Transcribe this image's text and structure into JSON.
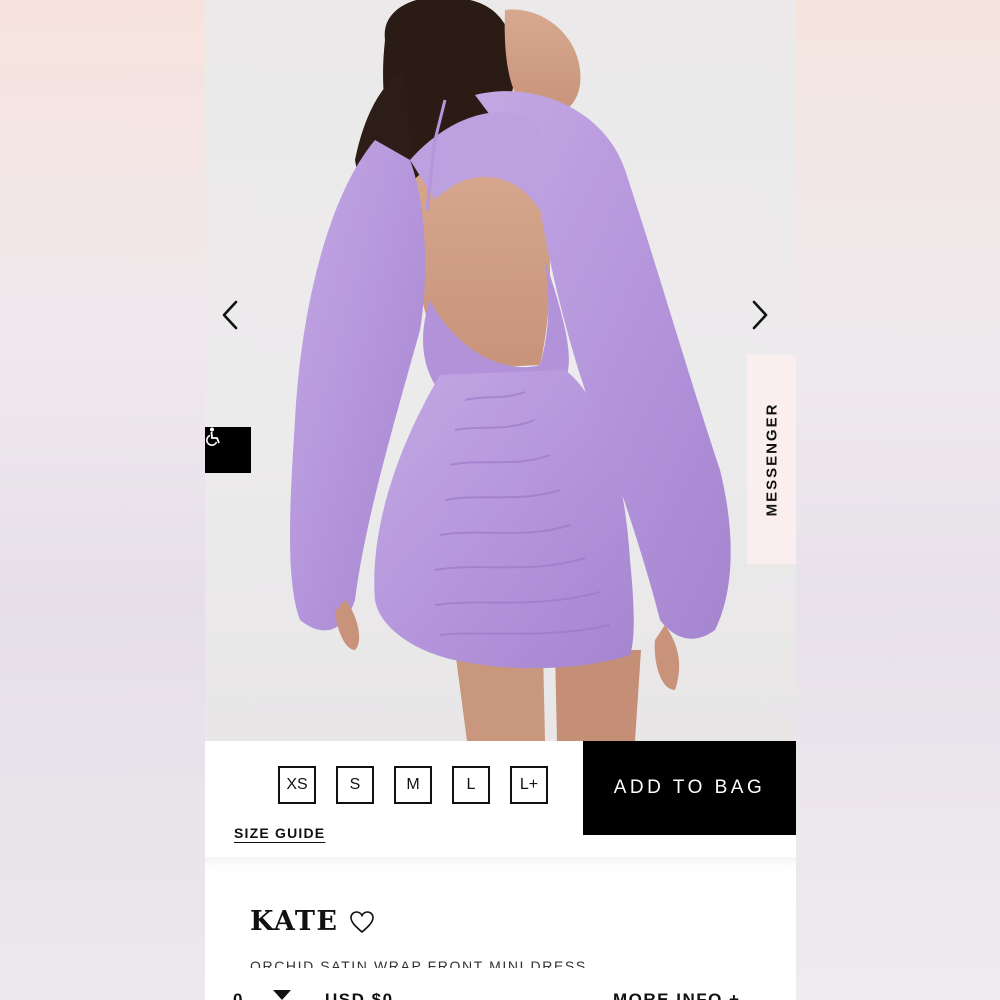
{
  "product_image": {
    "alt": "Model wearing orchid satin backless mini dress",
    "prev_icon": "chevron-left-icon",
    "next_icon": "chevron-right-icon"
  },
  "accessibility": {
    "icon": "wheelchair-icon"
  },
  "messenger": {
    "label": "MESSENGER"
  },
  "sizes": [
    "XS",
    "S",
    "M",
    "L",
    "L+"
  ],
  "size_guide": "SIZE GUIDE",
  "add_to_bag": "ADD TO BAG",
  "product": {
    "name": "KATE",
    "wishlist_icon": "heart-icon",
    "subtitle": "ORCHID SATIN WRAP FRONT MINI DRESS"
  },
  "footer": {
    "qty": "0",
    "price": "USD $0",
    "more_info": "MORE INFO +"
  },
  "colors": {
    "accent_dress": "#b79ad9",
    "button_bg": "#000000",
    "messenger_bg": "#fbeeee"
  }
}
